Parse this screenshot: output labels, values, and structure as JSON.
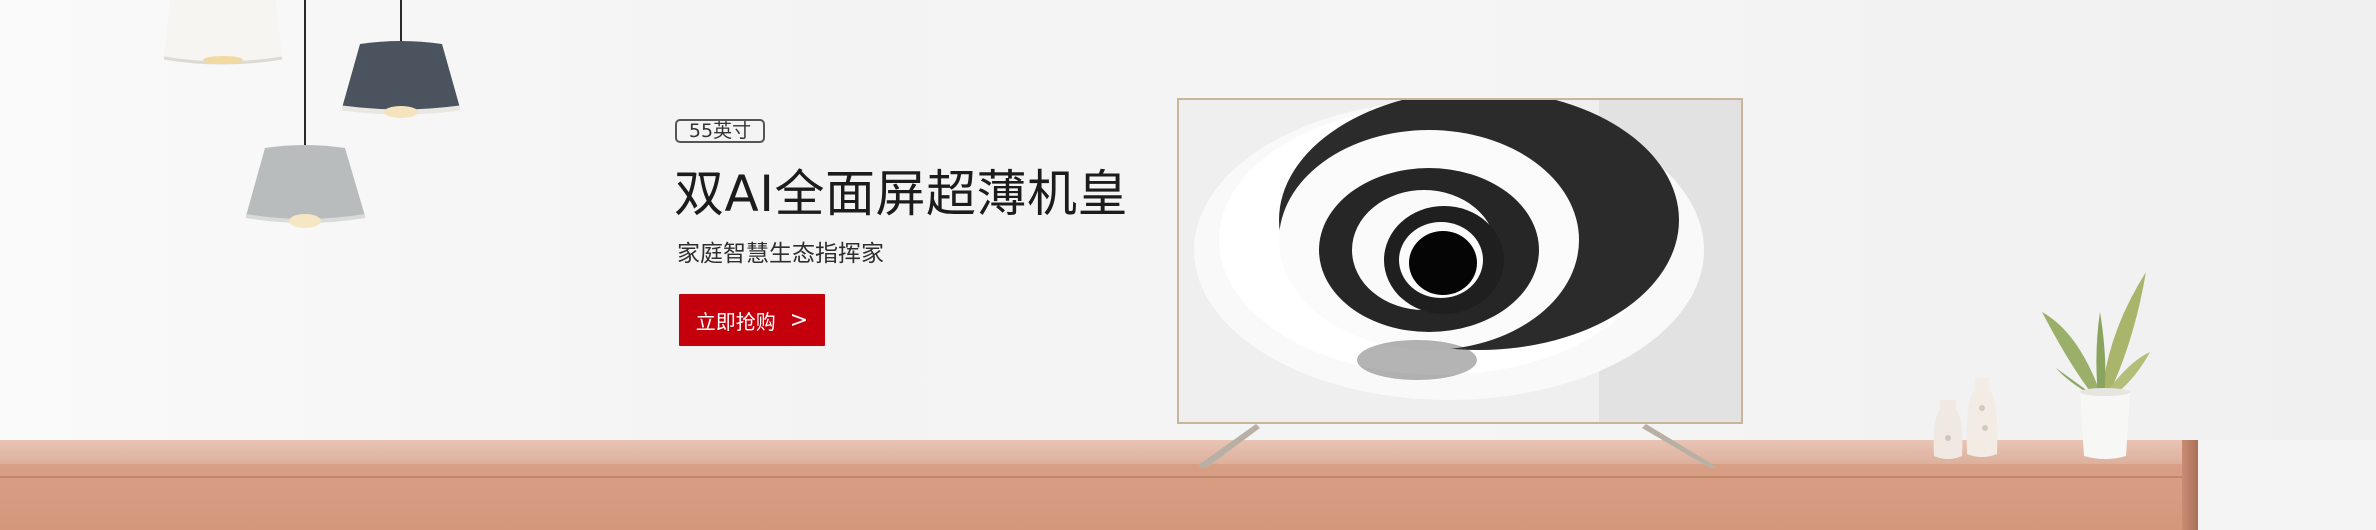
{
  "banner": {
    "size_badge": "55英寸",
    "headline": "双AI全面屏超薄机皇",
    "subline": "家庭智慧生态指挥家",
    "cta_label": "立即抢购",
    "cta_chevron": ">"
  },
  "colors": {
    "accent": "#c4000d",
    "wall": "#f4f4f4",
    "wood": "#d89f85",
    "tv_trim": "#c9b59a"
  },
  "icons": {
    "cta_arrow": "chevron-right-icon"
  }
}
